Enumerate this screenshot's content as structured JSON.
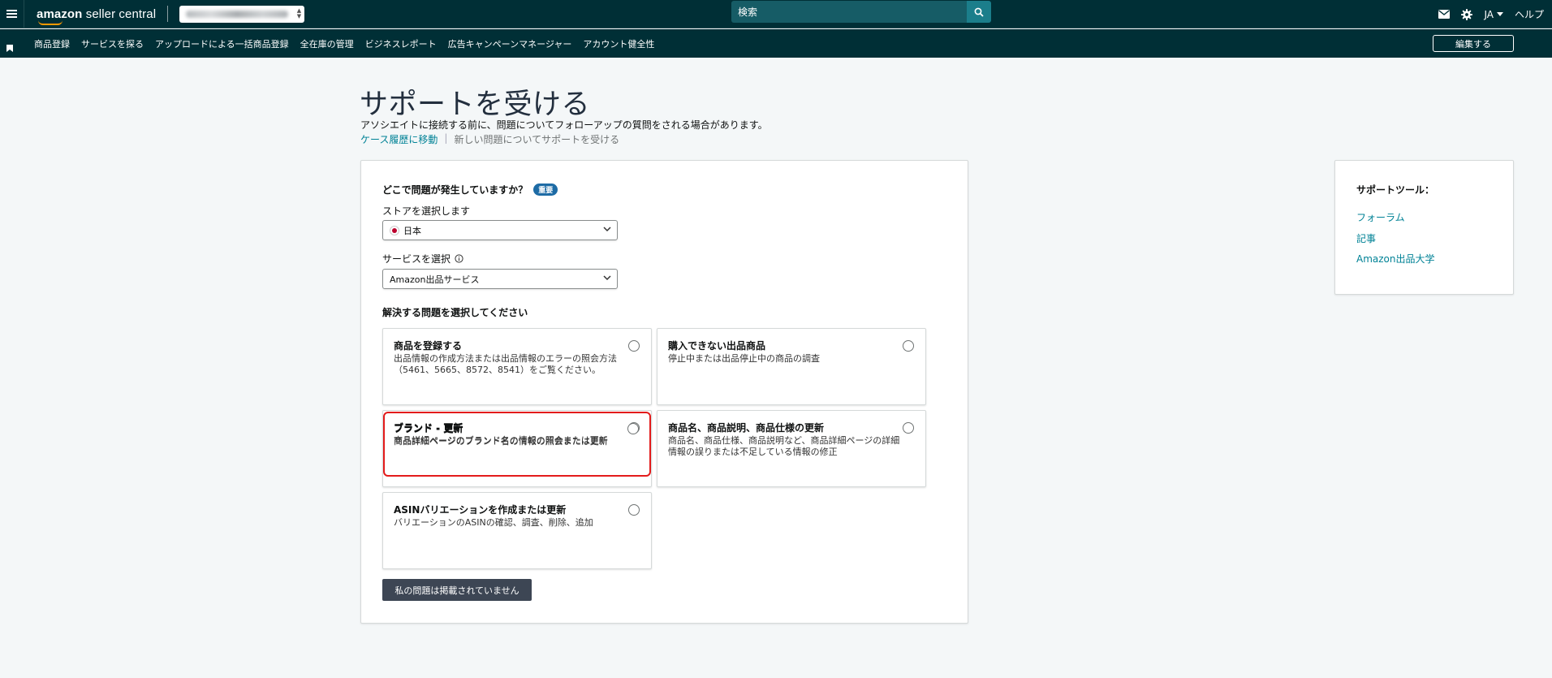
{
  "header": {
    "logo_brand": "amazon",
    "logo_product": " seller central",
    "search_placeholder": "検索",
    "language": "JA",
    "help": "ヘルプ",
    "icons": [
      "menu-icon",
      "mail-icon",
      "gear-icon",
      "search-icon"
    ]
  },
  "nav": {
    "items": [
      "商品登録",
      "サービスを探る",
      "アップロードによる一括商品登録",
      "全在庫の管理",
      "ビジネスレポート",
      "広告キャンペーンマネージャー",
      "アカウント健全性"
    ],
    "edit_label": "編集する"
  },
  "page": {
    "title": "サポートを受ける",
    "subtitle": "アソシエイトに接続する前に、問題についてフォローアップの質問をされる場合があります。",
    "breadcrumb_link": "ケース履歴に移動",
    "breadcrumb_current": "新しい問題についてサポートを受ける"
  },
  "form": {
    "question": "どこで問題が発生していますか？",
    "required_badge": "重要",
    "store_label": "ストアを選択します",
    "store_value": "日本",
    "service_label": "サービスを選択",
    "service_value": "Amazon出品サービス",
    "issue_label": "解決する問題を選択してください",
    "options": [
      {
        "title": "商品を登録する",
        "desc": "出品情報の作成方法または出品情報のエラーの照会方法（5461、5665、8572、8541）をご覧ください。"
      },
      {
        "title": "購入できない出品商品",
        "desc": "停止中または出品停止中の商品の調査"
      },
      {
        "title": "ブランド - 更新",
        "desc": "商品詳細ページのブランド名の情報の照会または更新"
      },
      {
        "title": "商品名、商品説明、商品仕様の更新",
        "desc": "商品名、商品仕様、商品説明など、商品詳細ページの詳細情報の誤りまたは不足している情報の修正"
      },
      {
        "title": "ASINバリエーションを作成または更新",
        "desc": "バリエーションのASINの確認、調査、削除、追加"
      }
    ],
    "not_listed_button": "私の問題は掲載されていません"
  },
  "sidebar": {
    "title": "サポートツール：",
    "links": [
      "フォーラム",
      "記事",
      "Amazon出品大学"
    ]
  },
  "colors": {
    "header_bg": "#002f36",
    "link": "#008296",
    "highlight": "#e31b1b",
    "badge": "#1d6ba5"
  }
}
